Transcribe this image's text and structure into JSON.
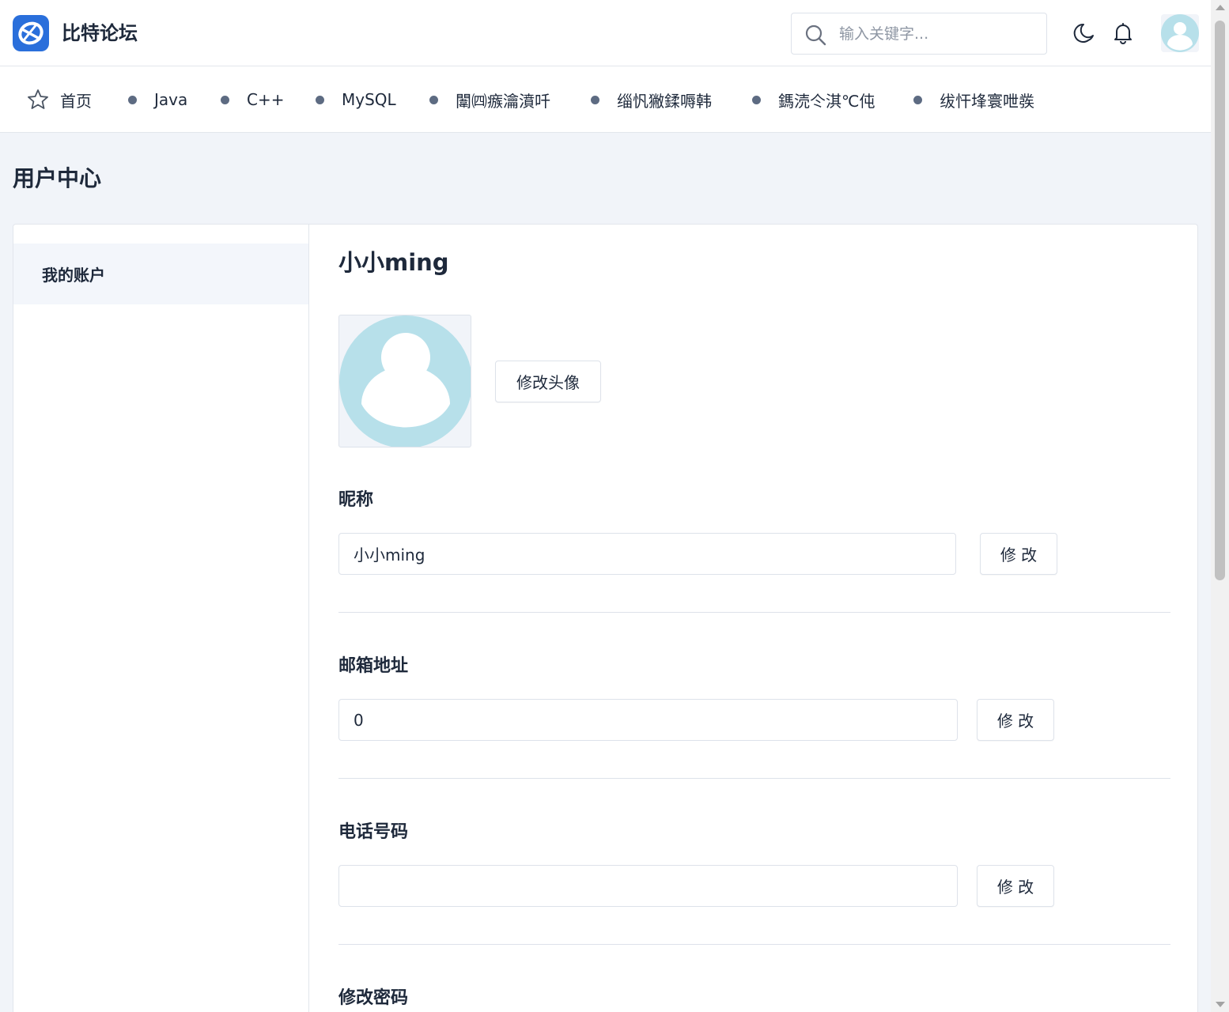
{
  "header": {
    "brand": "比特论坛",
    "search_placeholder": "输入关键字..."
  },
  "nav": {
    "items": [
      {
        "label": "首页"
      },
      {
        "label": "Java"
      },
      {
        "label": "C++"
      },
      {
        "label": "MySQL"
      },
      {
        "label": "闈㈣瘯瀹濆吀"
      },
      {
        "label": "缁忛獙鍒嗕韩"
      },
      {
        "label": "鎷涜仒淇℃伅"
      },
      {
        "label": "绂忓埄寰呭彂"
      }
    ]
  },
  "page": {
    "title": "用户中心"
  },
  "sidebar": {
    "items": [
      {
        "label": "我的账户"
      }
    ]
  },
  "profile": {
    "user_name": "小小ming",
    "change_avatar_label": "修改头像",
    "fields": [
      {
        "label": "昵称",
        "value": "小小ming",
        "button": "修 改"
      },
      {
        "label": "邮箱地址",
        "value": "0",
        "button": "修 改"
      },
      {
        "label": "电话号码",
        "value": "",
        "button": "修 改"
      },
      {
        "label": "修改密码"
      }
    ]
  },
  "colors": {
    "accent": "#2a6fdb",
    "avatar_bg": "#b7e0ea",
    "text": "#1e293b",
    "page_bg": "#f1f4f9"
  }
}
